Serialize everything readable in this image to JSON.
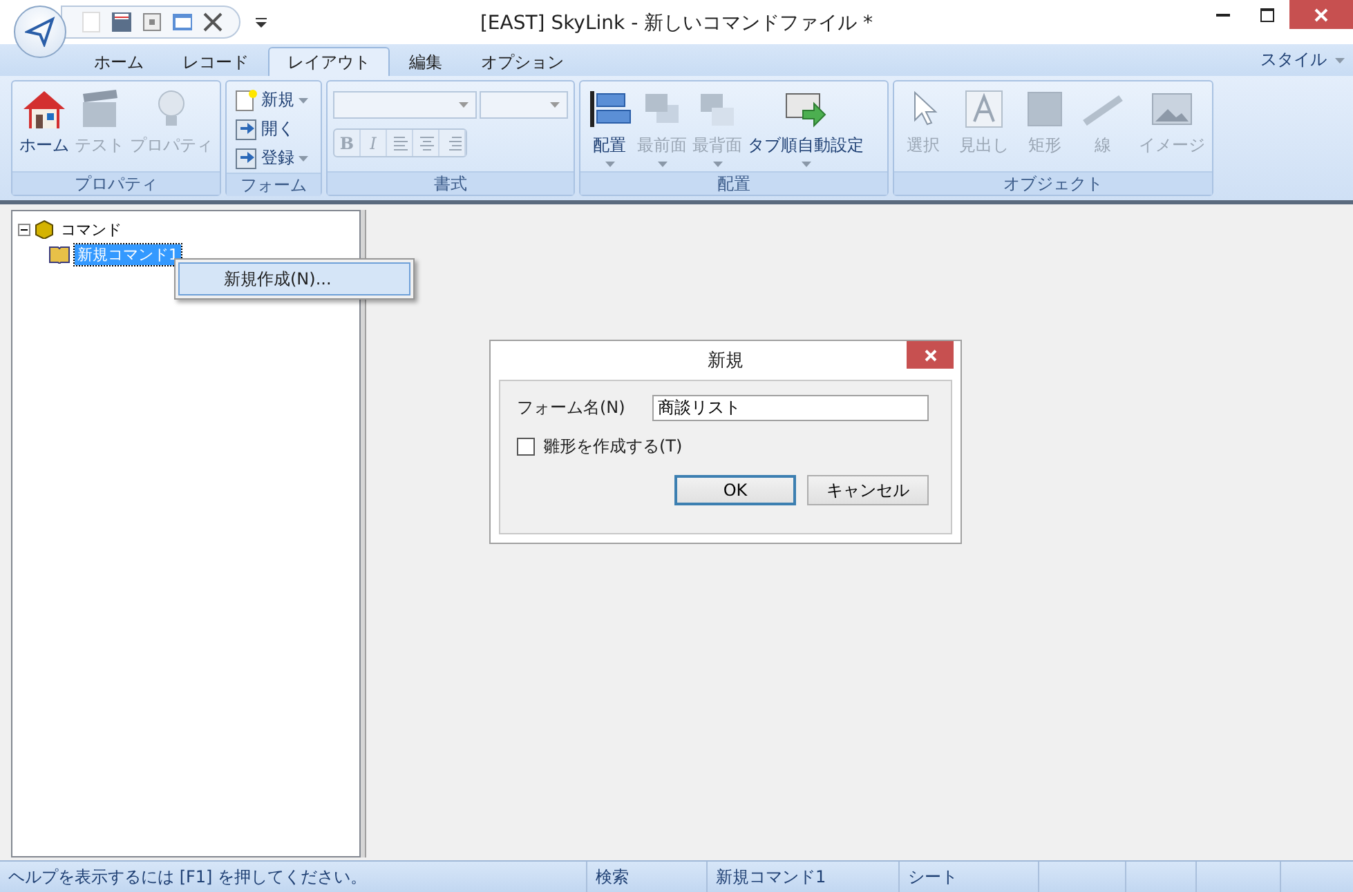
{
  "window": {
    "title": "[EAST] SkyLink - 新しいコマンドファイル *"
  },
  "tabs": [
    {
      "label": "ホーム",
      "selected": false
    },
    {
      "label": "レコード",
      "selected": false
    },
    {
      "label": "レイアウト",
      "selected": true
    },
    {
      "label": "編集",
      "selected": false
    },
    {
      "label": "オプション",
      "selected": false
    }
  ],
  "style_menu": {
    "label": "スタイル"
  },
  "ribbon": {
    "groups": [
      {
        "title": "プロパティ",
        "kind": "large",
        "buttons": [
          {
            "label": "ホーム",
            "disabled": false,
            "has_menu": false
          },
          {
            "label": "テスト",
            "disabled": true,
            "has_menu": false
          },
          {
            "label": "プロパティ",
            "disabled": true,
            "has_menu": false
          }
        ]
      },
      {
        "title": "フォーム",
        "kind": "small",
        "buttons": [
          {
            "label": "新規",
            "disabled": false,
            "has_menu": true
          },
          {
            "label": "開く",
            "disabled": false,
            "has_menu": false
          },
          {
            "label": "登録",
            "disabled": false,
            "has_menu": true
          }
        ]
      },
      {
        "title": "書式",
        "kind": "format",
        "buttons": [
          {
            "kind": "text",
            "label": "B",
            "disabled": true
          },
          {
            "kind": "text",
            "label": "I",
            "disabled": true
          },
          {
            "kind": "icon",
            "disabled": true
          },
          {
            "kind": "icon",
            "disabled": true
          },
          {
            "kind": "icon",
            "disabled": true
          }
        ]
      },
      {
        "title": "配置",
        "kind": "large",
        "buttons": [
          {
            "label": "配置",
            "disabled": false,
            "has_menu": true
          },
          {
            "label": "最前面",
            "disabled": true,
            "has_menu": true
          },
          {
            "label": "最背面",
            "disabled": true,
            "has_menu": true
          },
          {
            "label": "タブ順自動設定",
            "disabled": false,
            "has_menu": true
          }
        ]
      },
      {
        "title": "オブジェクト",
        "kind": "large",
        "buttons": [
          {
            "label": "選択",
            "disabled": true,
            "has_menu": false
          },
          {
            "label": "見出し",
            "disabled": true,
            "has_menu": false
          },
          {
            "label": "矩形",
            "disabled": true,
            "has_menu": false
          },
          {
            "label": "線",
            "disabled": true,
            "has_menu": false
          },
          {
            "label": "イメージ",
            "disabled": true,
            "has_menu": false
          }
        ]
      }
    ]
  },
  "tree": {
    "label": "コマンド",
    "expanded": true,
    "children": [
      {
        "label": "新規コマンド1",
        "selected": true
      }
    ]
  },
  "context_menu": {
    "items": [
      {
        "label": "新規作成(N)...",
        "selected": true
      }
    ]
  },
  "dialog": {
    "title": "新規",
    "field": {
      "label": "フォーム名(N)",
      "value": "商談リスト"
    },
    "checkbox": {
      "label": "雛形を作成する(T)",
      "checked": false
    },
    "buttons": [
      {
        "label": "OK",
        "default": true
      },
      {
        "label": "キャンセル",
        "default": false
      }
    ]
  },
  "status_bar": [
    "ヘルプを表示するには [F1] を押してください。",
    "検索",
    "新規コマンド1",
    "シート"
  ]
}
